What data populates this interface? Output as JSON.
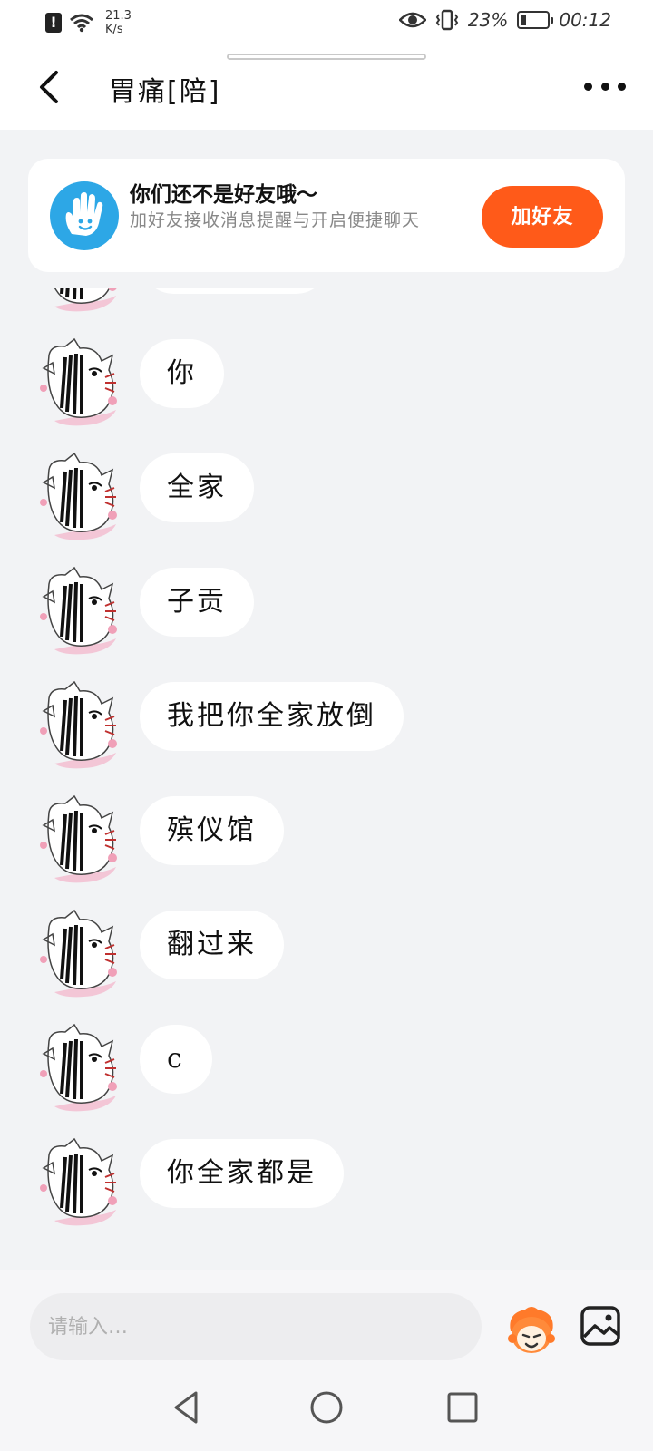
{
  "status_bar": {
    "speed_value": "21.3",
    "speed_unit": "K/s",
    "battery_percent": "23%",
    "battery_level": 0.23,
    "time": "00:12"
  },
  "header": {
    "title": "胃痛[陪]"
  },
  "friend_banner": {
    "title": "你们还不是好友哦～",
    "description": "加好友接收消息提醒与开启便捷聊天",
    "add_button_label": "加好友"
  },
  "messages": [
    {
      "text": ""
    },
    {
      "text": "你"
    },
    {
      "text": "全家"
    },
    {
      "text": "子贡"
    },
    {
      "text": "我把你全家放倒"
    },
    {
      "text": "殡仪馆"
    },
    {
      "text": "翻过来"
    },
    {
      "text": "c"
    },
    {
      "text": "你全家都是"
    }
  ],
  "input_bar": {
    "placeholder": "请输入…"
  },
  "colors": {
    "accent_orange": "#ff5a19",
    "hand_icon_blue": "#2da7e6",
    "background": "#f2f3f5"
  },
  "icons": {
    "back": "chevron-left-icon",
    "more": "more-dots-icon",
    "banner": "hand-wave-icon",
    "emoji": "emoji-face-icon",
    "image": "image-icon",
    "nav_back": "triangle-back-icon",
    "nav_home": "circle-home-icon",
    "nav_recent": "square-recent-icon"
  }
}
